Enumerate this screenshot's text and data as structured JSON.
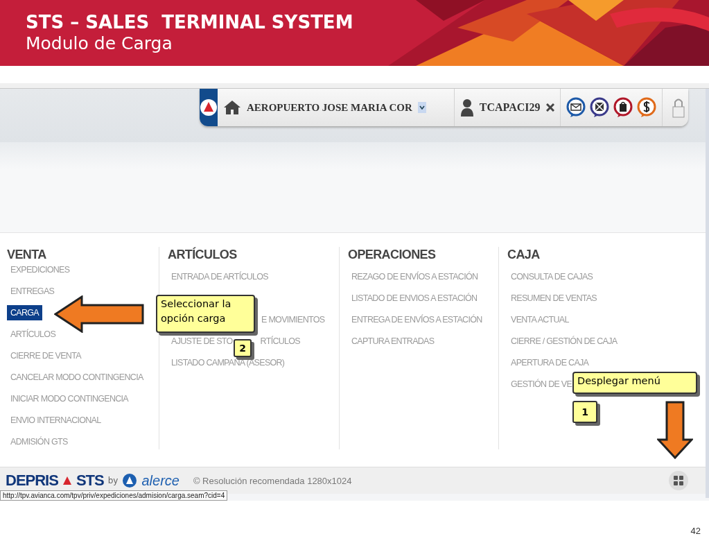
{
  "slide": {
    "title": "STS – SALES  TERMINAL SYSTEM",
    "subtitle": "Modulo de Carga",
    "page_number": "42"
  },
  "toolbar": {
    "location": "AEROPUERTO JOSE MARIA COR",
    "user": "TCAPACI29"
  },
  "menu": {
    "columns": [
      {
        "title": "VENTA",
        "items": [
          {
            "kind": "link",
            "text": "EXPEDICIONES",
            "selected": false
          },
          {
            "kind": "link",
            "text": "ENTREGAS",
            "selected": false
          },
          {
            "kind": "link",
            "text": "CARGA",
            "selected": true
          },
          {
            "kind": "link",
            "text": "ARTÍCULOS",
            "selected": false
          },
          {
            "kind": "link",
            "text": "CIERRE DE VENTA",
            "selected": false
          },
          {
            "kind": "link",
            "text": "CANCELAR MODO CONTINGENCIA",
            "selected": false
          },
          {
            "kind": "link",
            "text": "INICIAR MODO CONTINGENCIA",
            "selected": false
          },
          {
            "kind": "link",
            "text": "ENVIO INTERNACIONAL",
            "selected": false
          },
          {
            "kind": "link",
            "text": "ADMISIÓN GTS",
            "selected": false
          }
        ]
      },
      {
        "title": "ARTÍCULOS",
        "items": [
          {
            "kind": "link",
            "text": "ENTRADA DE ARTÍCULOS",
            "selected": false
          },
          {
            "kind": "covered"
          },
          {
            "kind": "tail",
            "text": "E MOVIMIENTOS",
            "selected": false
          },
          {
            "kind": "split",
            "parts": [
              "AJUSTE DE STO",
              "RTÍCULOS"
            ],
            "selected": false
          },
          {
            "kind": "link",
            "text": "LISTADO CAMPAÑA (ASESOR)",
            "selected": false
          }
        ]
      },
      {
        "title": "OPERACIONES",
        "items": [
          {
            "kind": "link",
            "text": "REZAGO DE ENVÍOS A ESTACIÓN",
            "selected": false
          },
          {
            "kind": "link",
            "text": "LISTADO DE ENVIOS A ESTACIÓN",
            "selected": false
          },
          {
            "kind": "link",
            "text": "ENTREGA DE ENVÍOS A ESTACIÓN",
            "selected": false
          },
          {
            "kind": "link",
            "text": "CAPTURA ENTRADAS",
            "selected": false
          }
        ]
      },
      {
        "title": "CAJA",
        "items": [
          {
            "kind": "link",
            "text": "CONSULTA DE CAJAS",
            "selected": false
          },
          {
            "kind": "link",
            "text": "RESUMEN DE VENTAS",
            "selected": false
          },
          {
            "kind": "link",
            "text": "VENTA ACTUAL",
            "selected": false
          },
          {
            "kind": "link",
            "text": "CIERRE / GESTIÓN DE CAJA",
            "selected": false
          },
          {
            "kind": "link",
            "text": "APERTURA DE CAJA",
            "selected": false
          },
          {
            "kind": "link",
            "text": "GESTIÓN DE VE",
            "selected": false
          }
        ]
      }
    ]
  },
  "footer": {
    "brand": "DEPRIS",
    "brand_suffix": "STS",
    "by": "by",
    "partner": "alerce",
    "copyright": "© Resolución recomendada 1280x1024"
  },
  "status_url": "http://tpv.avianca.com/tpv/priv/expediciones/admision/carga.seam?cid=4",
  "annotations": [
    {
      "kind": "left_arrow"
    },
    {
      "kind": "callout",
      "text": "Seleccionar la opción carga"
    },
    {
      "kind": "badge",
      "text": "2"
    },
    {
      "kind": "callout",
      "text": "Desplegar menú"
    },
    {
      "kind": "badge",
      "text": "1"
    },
    {
      "kind": "down_arrow"
    }
  ]
}
